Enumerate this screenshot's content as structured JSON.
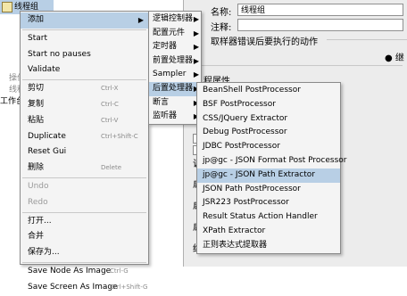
{
  "tree": {
    "items": [
      {
        "label": "线程组",
        "selected": true
      },
      {
        "label": "操作",
        "selected": false
      },
      {
        "label": "线程",
        "selected": false
      },
      {
        "label": "工作台",
        "selected": false
      }
    ]
  },
  "right": {
    "name_label": "名称:",
    "name_value": "线程组",
    "comment_label": "注释:",
    "action_label": "取样器错误后要执行的动作",
    "radio_label": "继",
    "props_label": "程属性",
    "labels": [
      "调",
      "启",
      "启",
      "启",
      "结"
    ]
  },
  "context_menu": {
    "items": [
      {
        "label": "添加",
        "shortcut": "",
        "submenu": true,
        "highlighted": true,
        "disabled": false
      },
      {
        "label": "Start",
        "shortcut": "",
        "disabled": false
      },
      {
        "label": "Start no pauses",
        "shortcut": "",
        "disabled": false
      },
      {
        "label": "Validate",
        "shortcut": "",
        "disabled": false
      },
      {
        "label": "剪切",
        "shortcut": "Ctrl-X",
        "disabled": false
      },
      {
        "label": "复制",
        "shortcut": "Ctrl-C",
        "disabled": false
      },
      {
        "label": "粘贴",
        "shortcut": "Ctrl-V",
        "disabled": false
      },
      {
        "label": "Duplicate",
        "shortcut": "Ctrl+Shift-C",
        "disabled": false
      },
      {
        "label": "Reset Gui",
        "shortcut": "",
        "disabled": false
      },
      {
        "label": "删除",
        "shortcut": "Delete",
        "disabled": false
      },
      {
        "label": "Undo",
        "shortcut": "",
        "disabled": true
      },
      {
        "label": "Redo",
        "shortcut": "",
        "disabled": true
      },
      {
        "label": "打开...",
        "shortcut": "",
        "disabled": false
      },
      {
        "label": "合并",
        "shortcut": "",
        "disabled": false
      },
      {
        "label": "保存为...",
        "shortcut": "",
        "disabled": false
      },
      {
        "label": "Save Node As Image",
        "shortcut": "Ctrl-G",
        "disabled": false
      },
      {
        "label": "Save Screen As Image",
        "shortcut": "Ctrl+Shift-G",
        "disabled": false
      }
    ]
  },
  "add_menu": {
    "items": [
      {
        "label": "逻辑控制器",
        "highlighted": false
      },
      {
        "label": "配置元件",
        "highlighted": false
      },
      {
        "label": "定时器",
        "highlighted": false
      },
      {
        "label": "前置处理器",
        "highlighted": false
      },
      {
        "label": "Sampler",
        "highlighted": false
      },
      {
        "label": "后置处理器",
        "highlighted": true
      },
      {
        "label": "断言",
        "highlighted": false
      },
      {
        "label": "监听器",
        "highlighted": false
      }
    ]
  },
  "post_menu": {
    "items": [
      {
        "label": "BeanShell PostProcessor",
        "highlighted": false
      },
      {
        "label": "BSF PostProcessor",
        "highlighted": false
      },
      {
        "label": "CSS/JQuery Extractor",
        "highlighted": false
      },
      {
        "label": "Debug PostProcessor",
        "highlighted": false
      },
      {
        "label": "JDBC PostProcessor",
        "highlighted": false
      },
      {
        "label": "jp@gc - JSON Format Post Processor",
        "highlighted": false
      },
      {
        "label": "jp@gc - JSON Path Extractor",
        "highlighted": true
      },
      {
        "label": "JSON Path PostProcessor",
        "highlighted": false
      },
      {
        "label": "JSR223 PostProcessor",
        "highlighted": false
      },
      {
        "label": "Result Status Action Handler",
        "highlighted": false
      },
      {
        "label": "XPath Extractor",
        "highlighted": false
      },
      {
        "label": "正则表达式提取器",
        "highlighted": false
      }
    ]
  },
  "colors": {
    "highlight": "#b8cfe5",
    "menu_bg": "#f4f4f4",
    "disabled": "#9a9a9a"
  }
}
